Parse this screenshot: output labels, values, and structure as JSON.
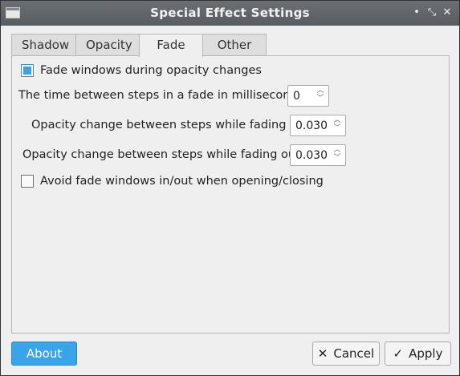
{
  "window": {
    "title": "Special Effect Settings",
    "controls": {
      "minimize": "•",
      "restore": "⤡",
      "close": "✕"
    }
  },
  "tabs": [
    {
      "label": "Shadow",
      "active": false
    },
    {
      "label": "Opacity",
      "active": false
    },
    {
      "label": "Fade",
      "active": true
    },
    {
      "label": "Other",
      "active": false
    }
  ],
  "fade": {
    "fade_windows": {
      "label": "Fade windows during opacity changes",
      "checked": true
    },
    "step_time": {
      "label": "The time between steps in a fade in milliseconds",
      "value": "0"
    },
    "fade_in_step": {
      "label": "Opacity change between steps while fading in",
      "value": "0.030"
    },
    "fade_out_step": {
      "label": "Opacity change between steps while fading out",
      "value": "0.030"
    },
    "avoid_fade": {
      "label": "Avoid fade windows in/out when opening/closing",
      "checked": false
    }
  },
  "buttons": {
    "about": "About",
    "cancel": "Cancel",
    "apply": "Apply"
  },
  "icons": {
    "cancel": "✕",
    "apply": "✓",
    "spin_up": "︿",
    "spin_down": "﹀"
  },
  "colors": {
    "accent": "#3ba3e8",
    "titlebar": "#5f646a"
  }
}
